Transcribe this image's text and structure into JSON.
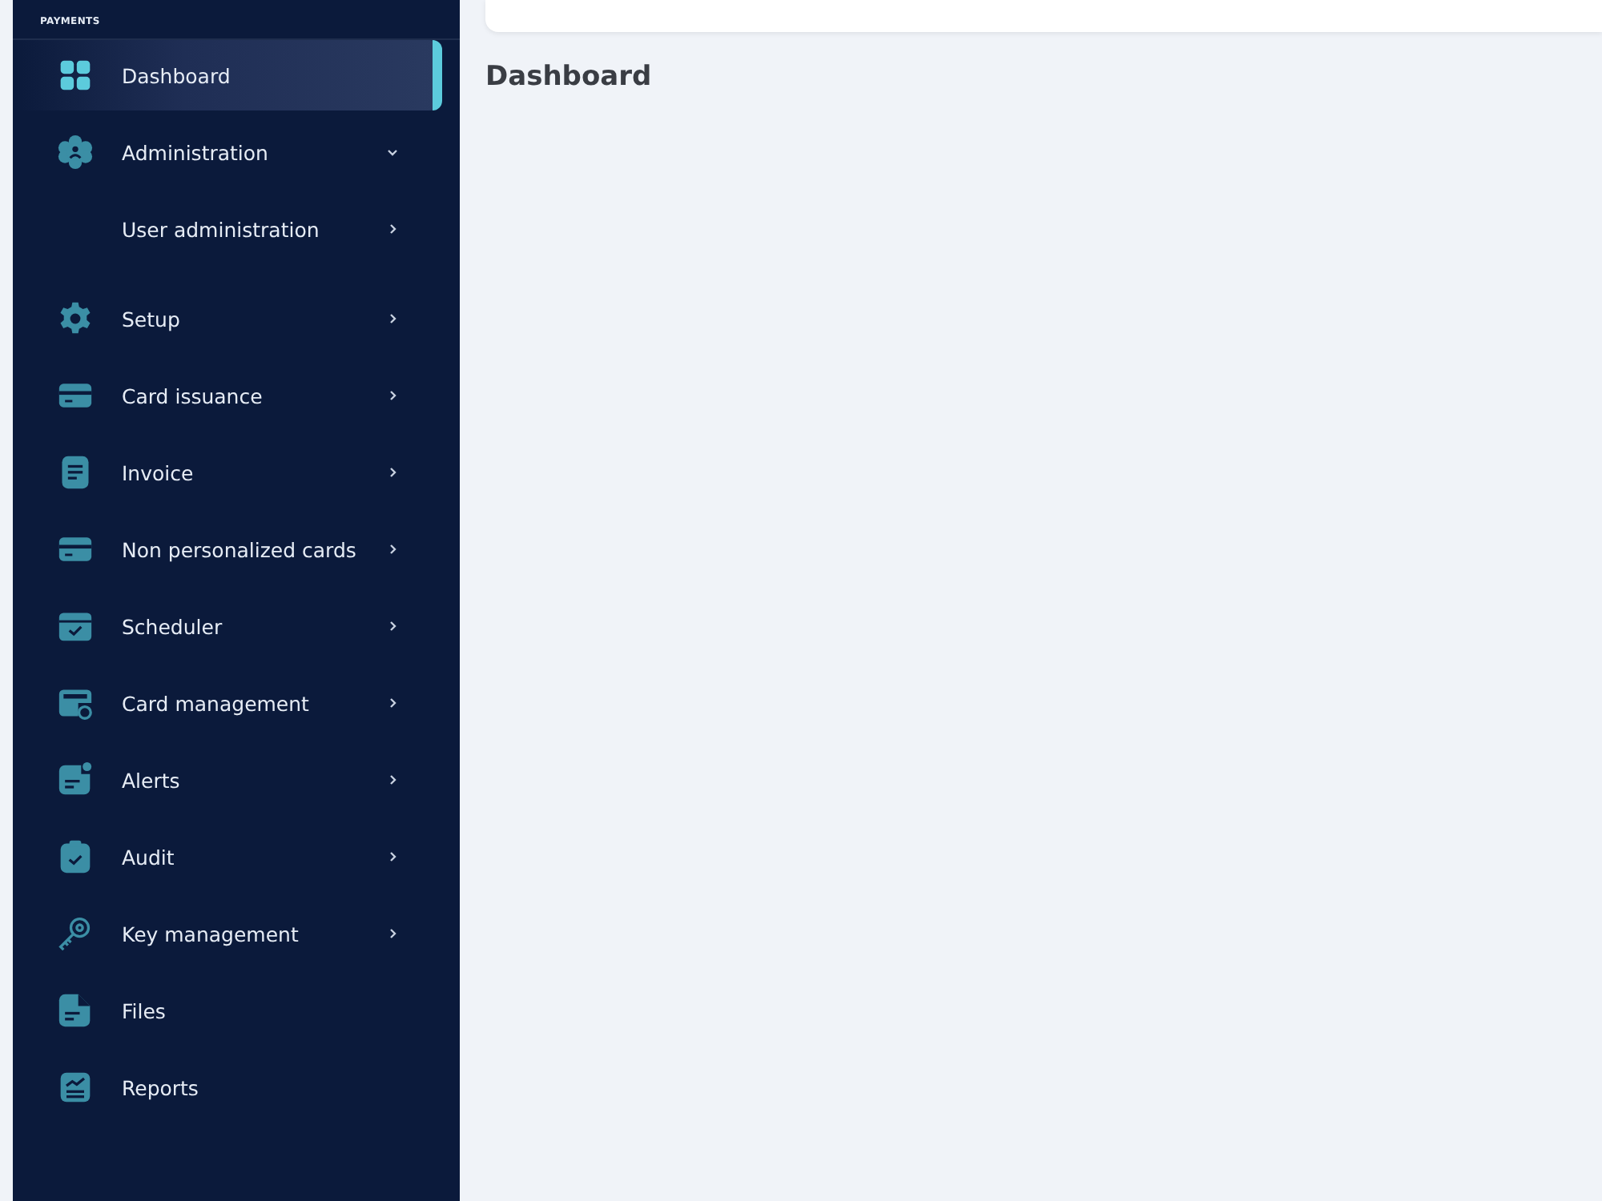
{
  "sidebar": {
    "logo": "PAYMENTS",
    "items": [
      {
        "label": "Dashboard",
        "kind": "link",
        "selected": true
      },
      {
        "label": "Administration",
        "kind": "group",
        "expanded": true,
        "selected": false,
        "children": [
          {
            "label": "User administration",
            "kind": "group",
            "expanded": false,
            "selected": false
          }
        ]
      },
      {
        "label": "Setup",
        "kind": "group",
        "expanded": false,
        "selected": false
      },
      {
        "label": "Card issuance",
        "kind": "group",
        "expanded": false,
        "selected": false
      },
      {
        "label": "Invoice",
        "kind": "group",
        "expanded": false,
        "selected": false
      },
      {
        "label": "Non personalized cards",
        "kind": "group",
        "expanded": false,
        "selected": false
      },
      {
        "label": "Scheduler",
        "kind": "group",
        "expanded": false,
        "selected": false
      },
      {
        "label": "Card management",
        "kind": "group",
        "expanded": false,
        "selected": false
      },
      {
        "label": "Alerts",
        "kind": "group",
        "expanded": false,
        "selected": false
      },
      {
        "label": "Audit",
        "kind": "group",
        "expanded": false,
        "selected": false
      },
      {
        "label": "Key management",
        "kind": "group",
        "expanded": false,
        "selected": false
      },
      {
        "label": "Files",
        "kind": "link",
        "selected": false
      },
      {
        "label": "Reports",
        "kind": "link",
        "selected": false
      }
    ]
  },
  "page": {
    "title": "Dashboard"
  }
}
